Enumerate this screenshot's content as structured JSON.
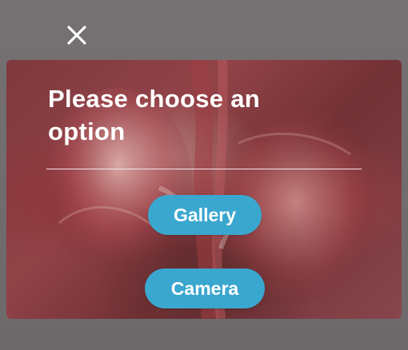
{
  "screen": {
    "close_icon": "close-icon"
  },
  "dialog": {
    "title": "Please choose an option",
    "background_image": "kidney-illustration",
    "buttons": {
      "gallery": "Gallery",
      "camera": "Camera"
    }
  },
  "colors": {
    "overlay": "#6f6a6c",
    "button": "#3aa7cf",
    "text": "#ffffff",
    "divider": "#f1e7e8"
  }
}
